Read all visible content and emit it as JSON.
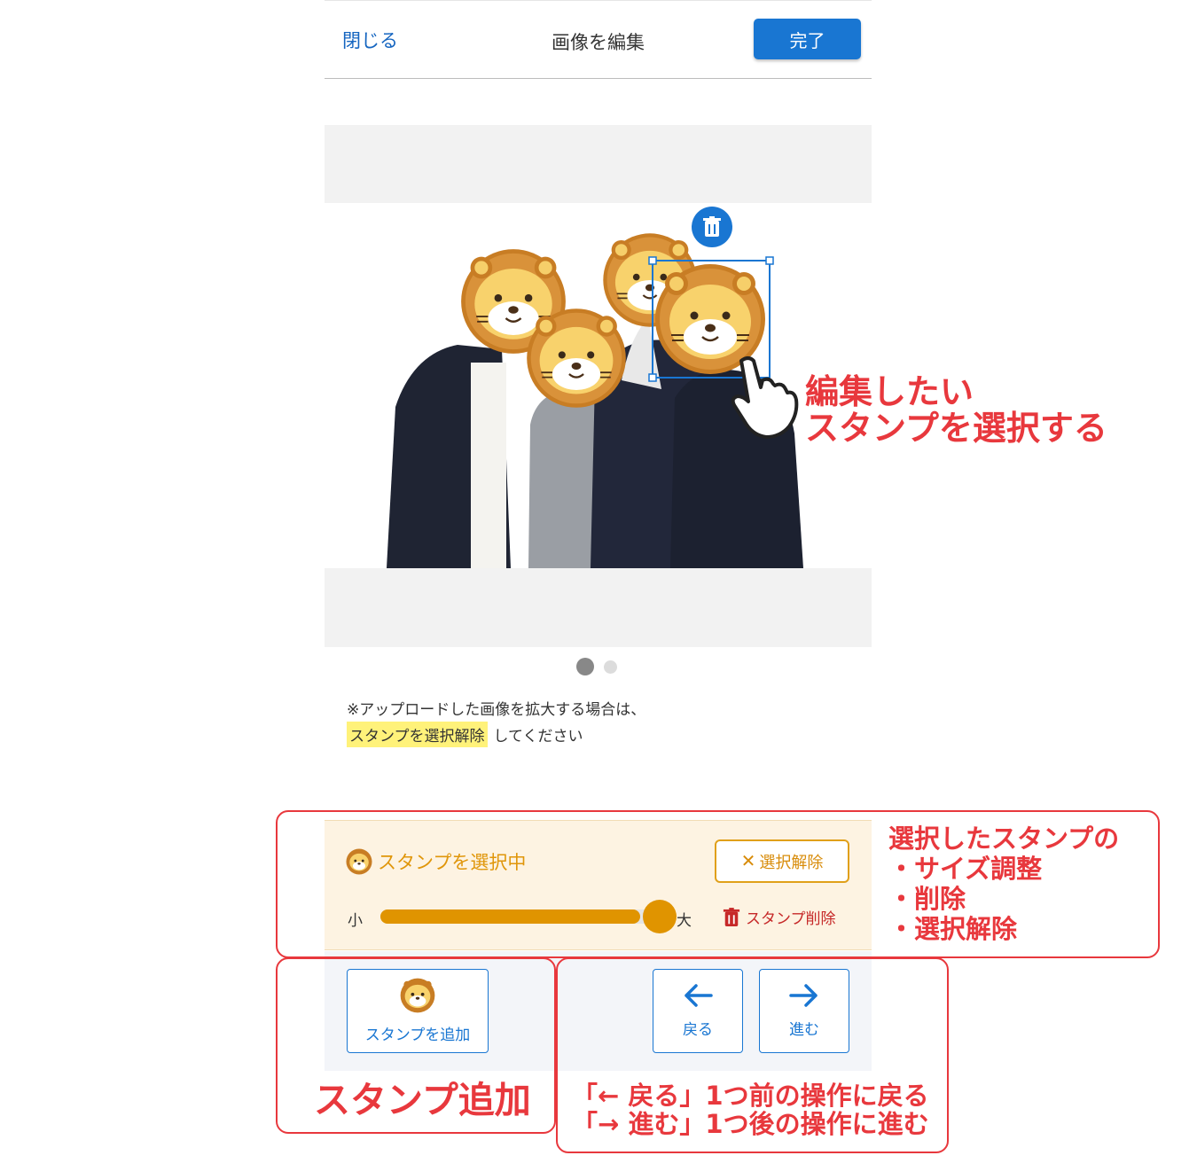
{
  "header": {
    "close_label": "閉じる",
    "title": "画像を編集",
    "done_label": "完了"
  },
  "pager": {
    "current": 1,
    "total": 2
  },
  "notice": {
    "line1": "※アップロードした画像を拡大する場合は、",
    "highlight": "スタンプを選択解除",
    "line2_suffix": "してください"
  },
  "stamp_panel": {
    "title": "スタンプを選択中",
    "deselect_label": "選択解除",
    "size_small_label": "小",
    "size_large_label": "大",
    "size_level": 0.93,
    "delete_label": "スタンプ削除"
  },
  "toolbar": {
    "add_stamp_label": "スタンプを追加",
    "back_label": "戻る",
    "forward_label": "進む"
  },
  "annotations": {
    "select_stamp": [
      "編集したい",
      "スタンプを選択する"
    ],
    "panel": [
      "選択したスタンプの",
      "・サイズ調整",
      "・削除",
      "・選択解除"
    ],
    "add": "スタンプ追加",
    "nav": [
      "「← 戻る」1つ前の操作に戻る",
      "「→ 進む」1つ後の操作に進む"
    ]
  },
  "colors": {
    "brand_blue": "#1976d2",
    "stamp_orange": "#e09400",
    "annotation_red": "#e8383d",
    "highlight_yellow": "#fff27a"
  }
}
